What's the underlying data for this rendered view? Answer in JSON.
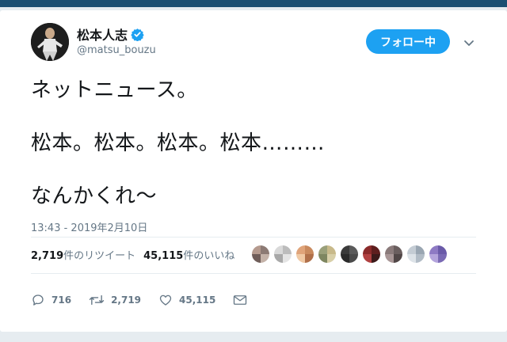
{
  "user": {
    "display_name": "松本人志",
    "handle": "@matsu_bouzu"
  },
  "follow_button_label": "フォロー中",
  "tweet": {
    "line1": "ネットニュース。",
    "line2": "松本。松本。松本。松本………",
    "line3": "なんかくれ〜"
  },
  "timestamp": "13:43 - 2019年2月10日",
  "stats": {
    "retweet_count": "2,719",
    "retweet_label": "件のリツイート",
    "like_count": "45,115",
    "like_label": "件のいいね"
  },
  "actions": {
    "reply_count": "716",
    "retweet_count": "2,719",
    "like_count": "45,115"
  },
  "colors": {
    "accent": "#1da1f2",
    "verified": "#1da1f2",
    "secondary_text": "#657786",
    "primary_text": "#14171a",
    "background": "#e6ecf0",
    "topbar": "#1b4f72"
  },
  "icons": {
    "verified": "verified-badge-icon",
    "caret": "chevron-down-icon",
    "reply": "reply-icon",
    "retweet": "retweet-icon",
    "like": "heart-icon",
    "dm": "envelope-icon"
  },
  "liker_avatar_count_shown": 9
}
